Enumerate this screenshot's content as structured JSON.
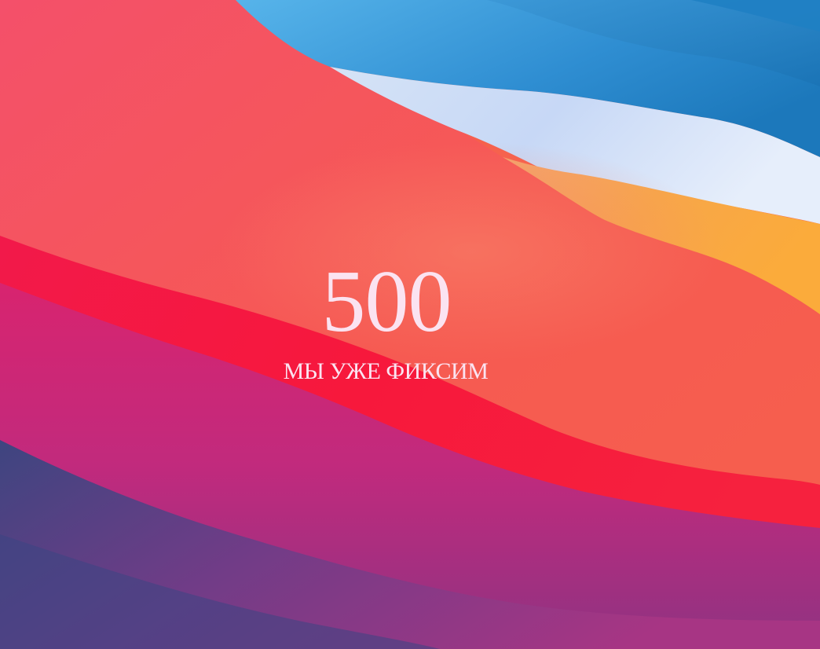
{
  "error": {
    "code": "500",
    "message": "МЫ УЖЕ ФИКСИМ"
  },
  "colors": {
    "text": "#fbe3f1",
    "sky_blue": "#3a9bd8",
    "deep_blue": "#1b7fc0",
    "light_band": "#dfe8fb",
    "orange_band": "#f9a13c",
    "coral": "#f6654f",
    "red": "#f6203f",
    "magenta": "#d0237a",
    "purple": "#4b3f86"
  }
}
